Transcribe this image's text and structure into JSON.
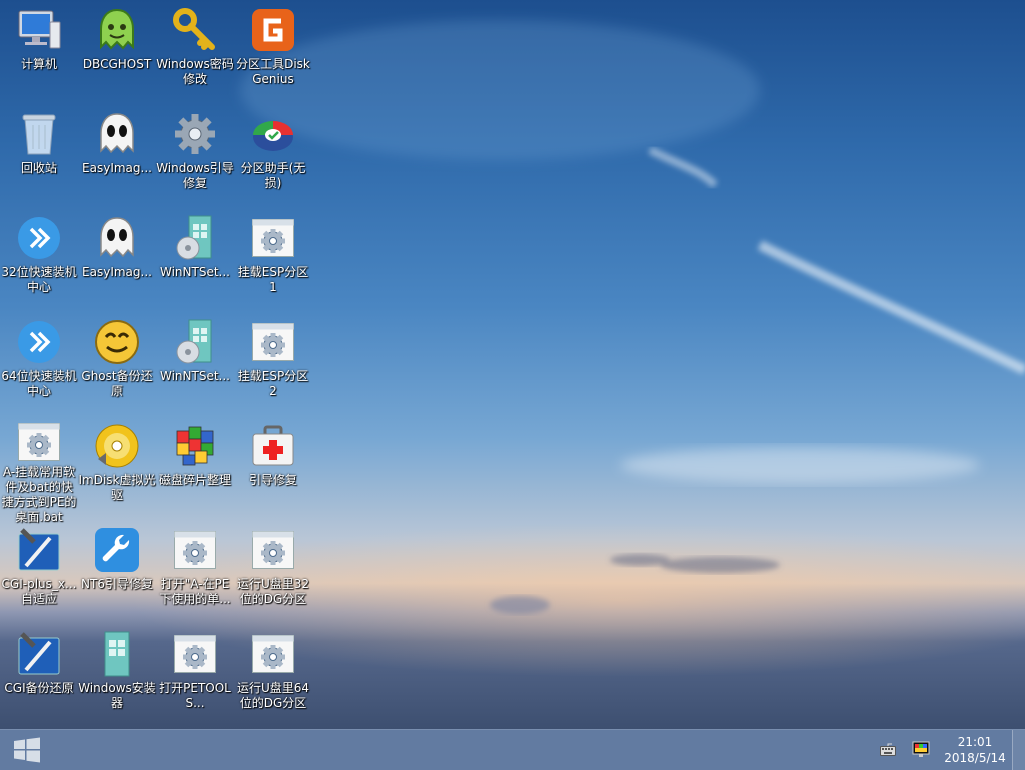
{
  "desktop": {
    "icons": [
      {
        "label": "计算机",
        "icon": "computer-icon"
      },
      {
        "label": "DBCGHOST",
        "icon": "ghost-green-icon"
      },
      {
        "label": "Windows密码修改",
        "icon": "key-icon"
      },
      {
        "label": "分区工具DiskGenius",
        "icon": "diskgenius-icon"
      },
      {
        "label": "回收站",
        "icon": "recycle-bin-icon"
      },
      {
        "label": "EasyImag...",
        "icon": "ghost-white-icon"
      },
      {
        "label": "Windows引导修复",
        "icon": "gear-icon"
      },
      {
        "label": "分区助手(无损)",
        "icon": "partition-assistant-icon"
      },
      {
        "label": "32位快速装机中心",
        "icon": "blue-arrow-icon"
      },
      {
        "label": "EasyImag...",
        "icon": "ghost-white-icon"
      },
      {
        "label": "WinNTSet...",
        "icon": "install-disc-icon"
      },
      {
        "label": "挂载ESP分区1",
        "icon": "script-gear-icon"
      },
      {
        "label": "64位快速装机中心",
        "icon": "blue-arrow-icon"
      },
      {
        "label": "Ghost备份还原",
        "icon": "ghost-yellow-icon"
      },
      {
        "label": "WinNTSet...",
        "icon": "install-disc-icon"
      },
      {
        "label": "挂载ESP分区2",
        "icon": "script-gear-icon"
      },
      {
        "label": "A-挂载常用软件及bat的快捷方式到PE的桌面.bat",
        "icon": "script-gear-icon"
      },
      {
        "label": "ImDisk虚拟光驱",
        "icon": "virtual-disc-icon"
      },
      {
        "label": "磁盘碎片整理",
        "icon": "defrag-icon"
      },
      {
        "label": "引导修复",
        "icon": "first-aid-icon"
      },
      {
        "label": "CGI-plus_x...自适应",
        "icon": "cgi-tool-icon"
      },
      {
        "label": "NT6引导修复",
        "icon": "wrench-icon"
      },
      {
        "label": "打开\"A-在PE下使用的单...",
        "icon": "script-gear-icon"
      },
      {
        "label": "运行U盘里32位的DG分区",
        "icon": "script-gear-icon"
      },
      {
        "label": "CGI备份还原",
        "icon": "cgi-tool-icon"
      },
      {
        "label": "Windows安装器",
        "icon": "installer-icon"
      },
      {
        "label": "打开PETOOLS...",
        "icon": "script-gear-icon"
      },
      {
        "label": "运行U盘里64位的DG分区",
        "icon": "script-gear-icon"
      }
    ]
  },
  "taskbar": {
    "start_icon": "windows-logo-icon",
    "tray_icons": [
      "keyboard-icon",
      "display-icon"
    ],
    "time": "21:01",
    "date": "2018/5/14"
  },
  "colors": {
    "taskbar": "#46648f",
    "sky_top": "#1d4f8f",
    "sky_horizon": "#d8c8bd",
    "label_text": "#ffffff"
  }
}
